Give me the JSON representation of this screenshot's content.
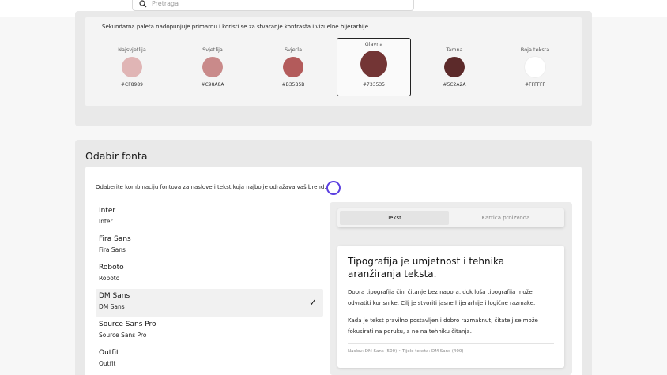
{
  "search": {
    "placeholder": "Pretraga"
  },
  "palette": {
    "description": "Sekundarna paleta nadopunjuje primarnu i koristi se za stvaranje kontrasta i vizuelne hijerarhije.",
    "swatches": [
      {
        "label": "Najsvjetlija",
        "hex": "#CF8989",
        "color": "#e0b5b5"
      },
      {
        "label": "Svjetlija",
        "hex": "#C98A8A",
        "color": "#c98a8a"
      },
      {
        "label": "Svjetla",
        "hex": "#B35B5B",
        "color": "#b35b5b"
      },
      {
        "label": "Glavna",
        "hex": "#733535",
        "color": "#733535"
      },
      {
        "label": "Tamna",
        "hex": "#5C2A2A",
        "color": "#5c2a2a"
      },
      {
        "label": "Boja teksta",
        "hex": "#FFFFFF",
        "color": "#ffffff"
      }
    ],
    "selected_index": 3
  },
  "font_section": {
    "title": "Odabir fonta",
    "description": "Odaberite kombinaciju fontova za naslove i tekst koja najbolje odražava vaš brend.",
    "fonts": [
      {
        "name": "Inter",
        "sub": "Inter"
      },
      {
        "name": "Fira Sans",
        "sub": "Fira Sans"
      },
      {
        "name": "Roboto",
        "sub": "Roboto"
      },
      {
        "name": "DM Sans",
        "sub": "DM Sans"
      },
      {
        "name": "Source Sans Pro",
        "sub": "Source Sans Pro"
      },
      {
        "name": "Outfit",
        "sub": "Outfit"
      }
    ],
    "selected_font": "DM Sans",
    "check_glyph": "✓"
  },
  "preview": {
    "tabs": [
      "Tekst",
      "Kartica proizvoda"
    ],
    "active_tab": "Tekst",
    "heading": "Tipografija je umjetnost i tehnika aranžiranja teksta.",
    "paragraph1": "Dobra tipografija čini čitanje bez napora, dok loša tipografija može odvratiti korisnike. Cilj je stvoriti jasne hijerarhije i logične razmake.",
    "paragraph2": "Kada je tekst pravilno postavljen i dobro razmaknut, čitatelj se može fokusirati na poruku, a ne na tehniku čitanja.",
    "meta": "Naslov: DM Sans (500) • Tijelo teksta: DM Sans (400)"
  },
  "colors": {
    "accent_ring": "#5b3fe0",
    "primary": "#733535"
  },
  "icons": {
    "search": "search-icon",
    "check": "checkmark-icon"
  }
}
